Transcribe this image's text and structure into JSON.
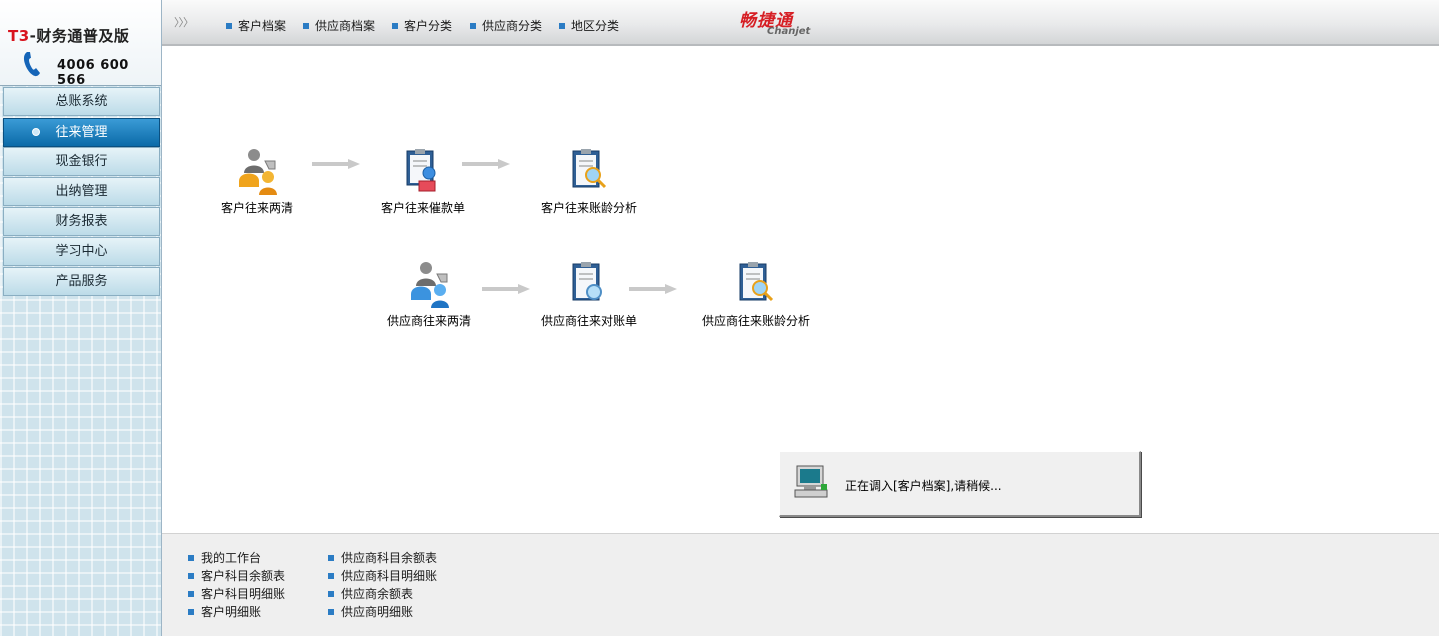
{
  "app": {
    "product_prefix": "T3",
    "product_suffix": "-财务通普及版",
    "hotline": "4006 600 566",
    "brand_cn": "畅捷通",
    "brand_en": "Chanjet"
  },
  "sidebar": {
    "items": [
      {
        "label": "总账系统",
        "active": false
      },
      {
        "label": "往来管理",
        "active": true
      },
      {
        "label": "现金银行",
        "active": false
      },
      {
        "label": "出纳管理",
        "active": false
      },
      {
        "label": "财务报表",
        "active": false
      },
      {
        "label": "学习中心",
        "active": false
      },
      {
        "label": "产品服务",
        "active": false
      }
    ]
  },
  "toolbar": {
    "chevrons": "〉〉〉",
    "links": [
      "客户档案",
      "供应商档案",
      "客户分类",
      "供应商分类",
      "地区分类"
    ]
  },
  "flow": {
    "customer": [
      {
        "label": "客户往来两清",
        "icon": "customer-clear-icon"
      },
      {
        "label": "客户往来催款单",
        "icon": "customer-dunning-icon"
      },
      {
        "label": "客户往来账龄分析",
        "icon": "customer-aging-icon"
      }
    ],
    "supplier": [
      {
        "label": "供应商往来两清",
        "icon": "supplier-clear-icon"
      },
      {
        "label": "供应商往来对账单",
        "icon": "supplier-statement-icon"
      },
      {
        "label": "供应商往来账龄分析",
        "icon": "supplier-aging-icon"
      }
    ]
  },
  "loading": {
    "message": "正在调入[客户档案],请稍候..."
  },
  "bottom_links": {
    "col1": [
      "我的工作台",
      "客户科目余额表",
      "客户科目明细账",
      "客户明细账"
    ],
    "col2": [
      "供应商科目余额表",
      "供应商科目明细账",
      "供应商余额表",
      "供应商明细账"
    ]
  },
  "colors": {
    "accent_blue": "#0b6aa8",
    "brand_red": "#d61e24",
    "bullet_blue": "#2b7cc4"
  }
}
